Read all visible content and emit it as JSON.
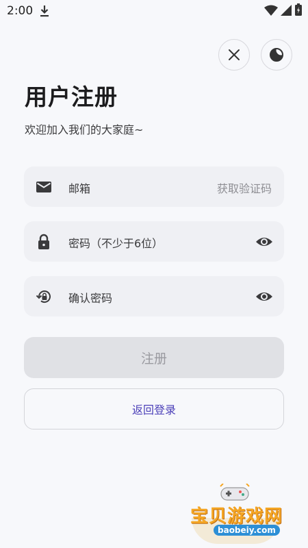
{
  "status_bar": {
    "time": "2:00",
    "icons": [
      "download-icon",
      "wifi-icon",
      "signal-icon",
      "battery-icon"
    ]
  },
  "top_actions": {
    "close_icon": "close-icon",
    "theme_icon": "moon-icon"
  },
  "header": {
    "title": "用户注册",
    "subtitle": "欢迎加入我们的大家庭~"
  },
  "form": {
    "email": {
      "icon": "mail-icon",
      "placeholder": "邮箱",
      "action_label": "获取验证码"
    },
    "password": {
      "icon": "lock-icon",
      "placeholder": "密码（不少于6位）",
      "toggle_icon": "eye-icon"
    },
    "confirm": {
      "icon": "lock-reset-icon",
      "placeholder": "确认密码",
      "toggle_icon": "eye-icon"
    }
  },
  "buttons": {
    "register": "注册",
    "back_to_login": "返回登录"
  },
  "watermark": {
    "text": "宝贝游戏网",
    "url": "baobeiy.com"
  },
  "colors": {
    "background": "#f7f8fb",
    "field_bg": "#eff0f4",
    "register_disabled_bg": "#e0e1e5",
    "link_accent": "#4b3fb8"
  }
}
